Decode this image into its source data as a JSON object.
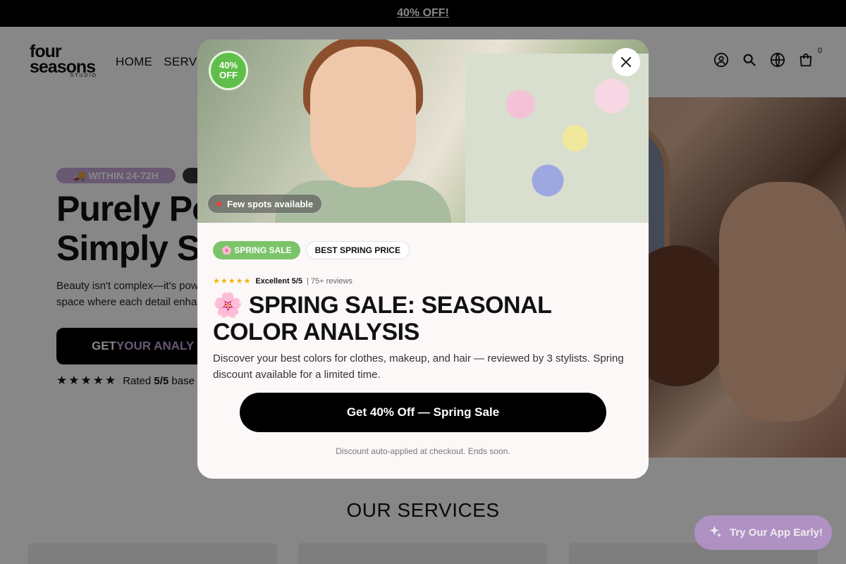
{
  "announcement": {
    "text": "40% OFF!"
  },
  "header": {
    "logo_top": "four",
    "logo_bottom": "seasons",
    "logo_sub": "STUDIO",
    "nav": [
      "HOME",
      "SERVIC"
    ],
    "cart_count": "0"
  },
  "hero": {
    "pill1": "🚚 WITHIN 24-72H",
    "title_line1": "Purely Po",
    "title_line2": "Simply St",
    "sub_line1": "Beauty isn't complex—it's pow",
    "sub_line2": "space where each detail enhar",
    "button_prefix": "GET ",
    "button_accent": "YOUR ANALY",
    "rating_stars": "★★★★★",
    "rating_text_pre": "Rated ",
    "rating_text_bold": "5/5",
    "rating_text_post": " base"
  },
  "services": {
    "title": "OUR SERVICES"
  },
  "app_button": {
    "label": "Try Our App Early!"
  },
  "modal": {
    "badge_line1": "40%",
    "badge_line2": "OFF",
    "spots_label": "Few spots available",
    "tag_sale": "🌸 SPRING SALE",
    "tag_price": "BEST SPRING PRICE",
    "rating_stars": "★★★★★",
    "rating_excellent": "Excellent 5/5",
    "rating_reviews": "| 75+ reviews",
    "title": "🌸 SPRING SALE: SEASONAL COLOR ANALYSIS",
    "description": "Discover your best colors for clothes, makeup, and hair — reviewed by 3 stylists. Spring discount available for a limited time.",
    "cta": "Get 40% Off — Spring Sale",
    "footnote": "Discount auto-applied at checkout. Ends soon."
  }
}
